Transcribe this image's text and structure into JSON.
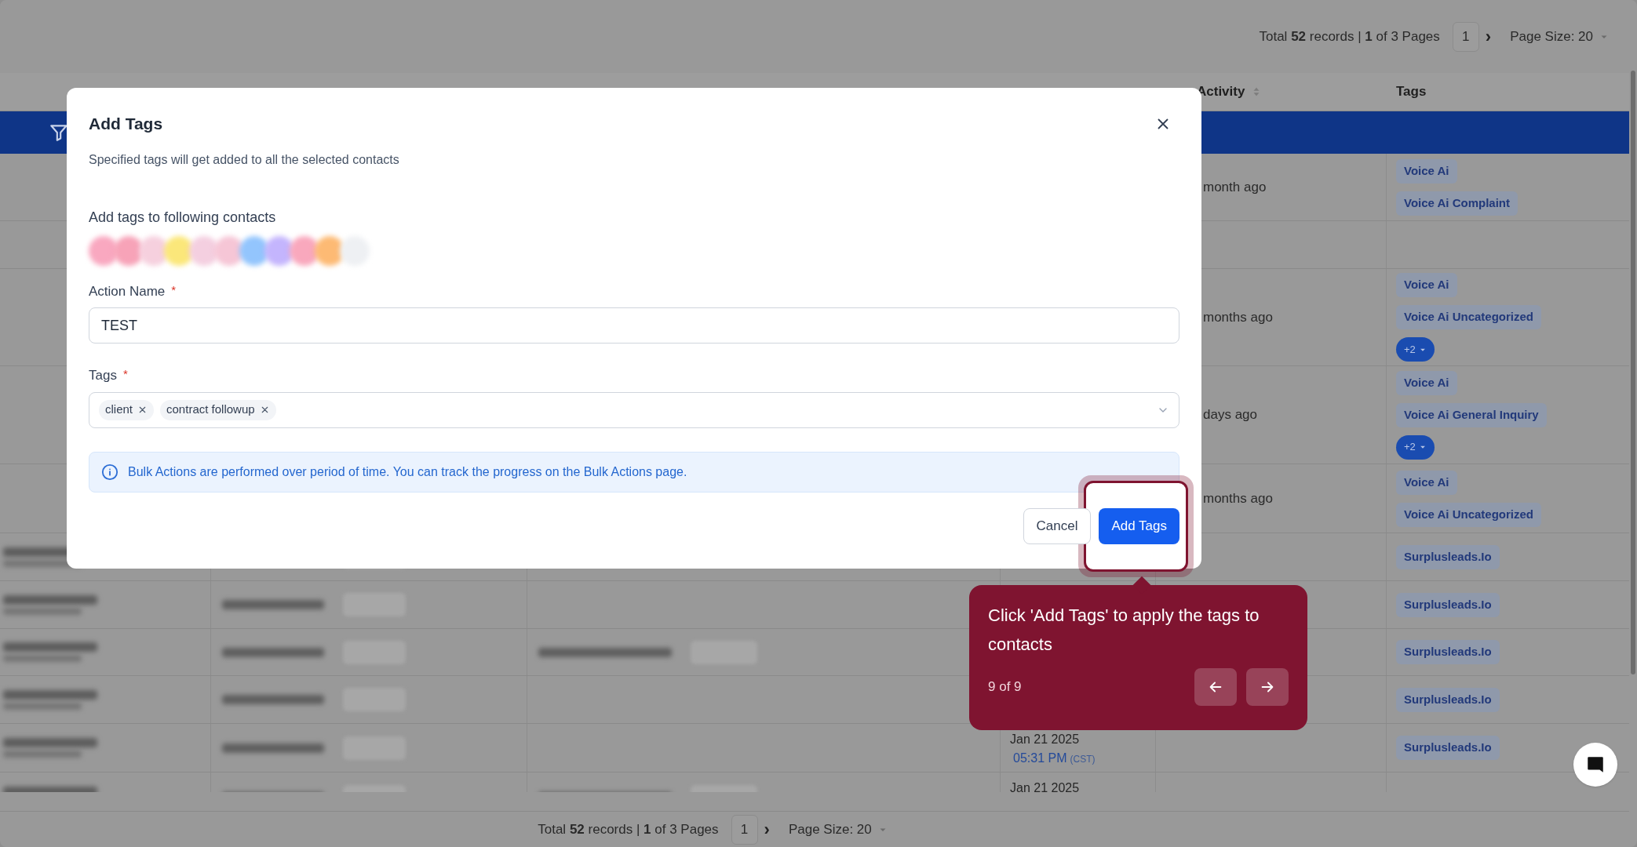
{
  "top_pagination": {
    "total_prefix": "Total",
    "total_count": "52",
    "total_suffix": "records",
    "separator": "|",
    "page_current": "1",
    "page_of": "of 3 Pages",
    "page_box": "1",
    "next": "›",
    "page_size": "Page Size: 20"
  },
  "table": {
    "columns": [
      {
        "kind": "activity",
        "label": "Activity"
      },
      {
        "kind": "tags",
        "label": "Tags"
      }
    ],
    "rows": [
      {
        "activity": "month ago",
        "tags": [
          "Voice Ai",
          "Voice Ai Complaint"
        ]
      },
      {
        "activity": "",
        "tags": []
      },
      {
        "activity": "months ago",
        "tags": [
          "Voice Ai",
          "Voice Ai Uncategorized"
        ],
        "more": "+2"
      },
      {
        "activity": "days ago",
        "tags": [
          "Voice Ai",
          "Voice Ai General Inquiry"
        ],
        "more": "+2"
      },
      {
        "activity": "months ago",
        "tags": [
          "Voice Ai",
          "Voice Ai Uncategorized"
        ]
      },
      {
        "tags": [
          "Surplusleads.Io"
        ]
      },
      {
        "tags": [
          "Surplusleads.Io"
        ],
        "has_email": false
      },
      {
        "tags": [
          "Surplusleads.Io"
        ],
        "has_email": true
      },
      {
        "tags": [
          "Surplusleads.Io"
        ],
        "has_email": false
      },
      {
        "tags": [
          "Surplusleads.Io"
        ],
        "has_email": false,
        "date": "Jan 21 2025",
        "time": "05:31 PM",
        "tz": "(CST)"
      },
      {
        "tags": [],
        "has_email": true,
        "date": "Jan 21 2025"
      }
    ]
  },
  "bottom_pagination": {
    "total_prefix": "Total",
    "total_count": "52",
    "total_suffix": "records",
    "separator": "|",
    "page_current": "1",
    "page_of": "of 3 Pages",
    "page_box": "1",
    "next": "›",
    "page_size": "Page Size: 20"
  },
  "modal": {
    "title": "Add Tags",
    "subtitle": "Specified tags will get added to all the selected contacts",
    "contacts_label": "Add tags to following contacts",
    "avatars": [
      {
        "color": "#f9a8c0"
      },
      {
        "color": "#f7a3b8"
      },
      {
        "color": "#f6d0de"
      },
      {
        "color": "#fbe77a"
      },
      {
        "color": "#f4cfe0"
      },
      {
        "color": "#f6c6d6"
      },
      {
        "color": "#93c5fd"
      },
      {
        "color": "#c4b5fd"
      },
      {
        "color": "#f9a8bd"
      },
      {
        "color": "#fdba74"
      },
      {
        "color": "#eef0f3"
      }
    ],
    "action_name": {
      "label": "Action Name",
      "required_mark": "*",
      "value": "TEST"
    },
    "tags_field": {
      "label": "Tags",
      "required_mark": "*",
      "chips": [
        "client",
        "contract followup"
      ]
    },
    "info": "Bulk Actions are performed over period of time. You can track the progress on the Bulk Actions page.",
    "buttons": [
      {
        "kind": "secondary",
        "label": "Cancel",
        "highlighted": false
      },
      {
        "kind": "primary",
        "label": "Add Tags",
        "highlighted": true
      }
    ]
  },
  "tour_tip": {
    "text": "Click 'Add Tags' to apply the tags to contacts",
    "step": "9 of 9"
  }
}
